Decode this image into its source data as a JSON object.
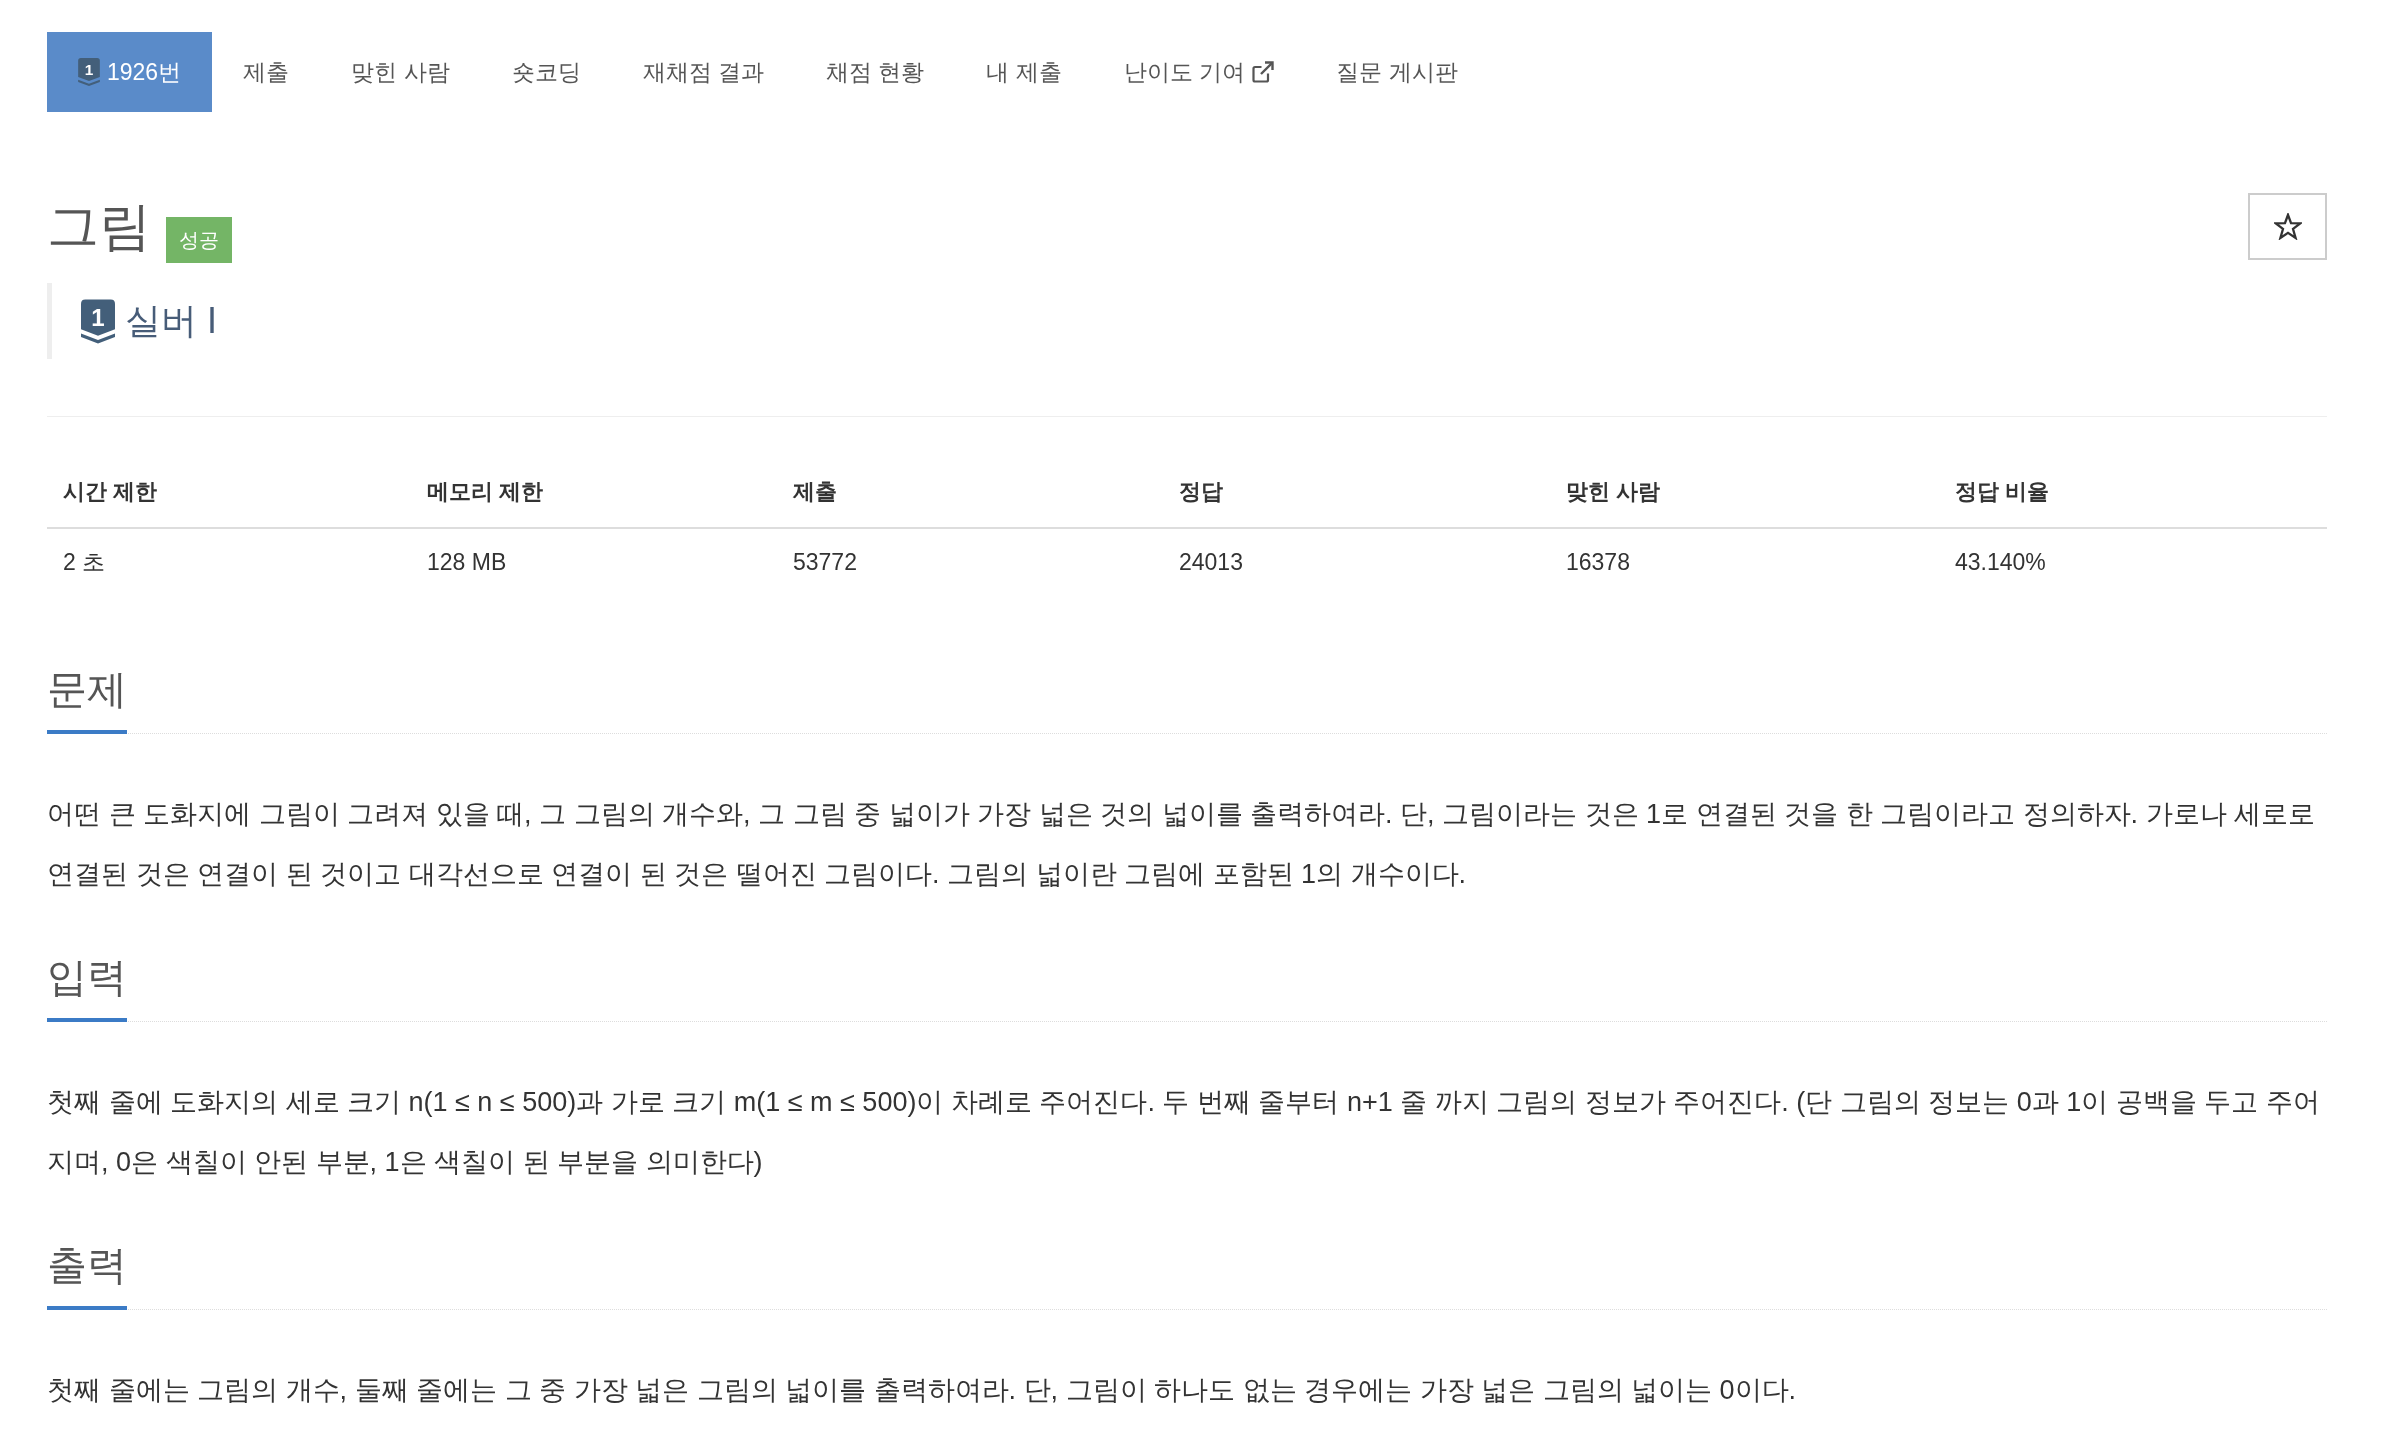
{
  "tabs": [
    {
      "label": "1926번",
      "tier_digit": "1",
      "selected": true,
      "external": false
    },
    {
      "label": "제출",
      "selected": false,
      "external": false
    },
    {
      "label": "맞힌 사람",
      "selected": false,
      "external": false
    },
    {
      "label": "숏코딩",
      "selected": false,
      "external": false
    },
    {
      "label": "재채점 결과",
      "selected": false,
      "external": false
    },
    {
      "label": "채점 현황",
      "selected": false,
      "external": false
    },
    {
      "label": "내 제출",
      "selected": false,
      "external": false
    },
    {
      "label": "난이도 기여",
      "selected": false,
      "external": true
    },
    {
      "label": "질문 게시판",
      "selected": false,
      "external": false
    }
  ],
  "problem": {
    "title": "그림",
    "status": "성공",
    "starred": false
  },
  "tier": {
    "digit": "1",
    "name": "실버 I"
  },
  "stats": {
    "columns": [
      "시간 제한",
      "메모리 제한",
      "제출",
      "정답",
      "맞힌 사람",
      "정답 비율"
    ],
    "rows": [
      [
        "2 초",
        "128 MB",
        "53772",
        "24013",
        "16378",
        "43.140%"
      ]
    ]
  },
  "sections": [
    {
      "heading": "문제",
      "text": "어떤 큰 도화지에 그림이 그려져 있을 때, 그 그림의 개수와, 그 그림 중 넓이가 가장 넓은 것의 넓이를 출력하여라. 단, 그림이라는 것은 1로 연결된 것을 한 그림이라고 정의하자. 가로나 세로로 연결된 것은 연결이 된 것이고 대각선으로 연결이 된 것은 떨어진 그림이다. 그림의 넓이란 그림에 포함된 1의 개수이다."
    },
    {
      "heading": "입력",
      "text": "첫째 줄에 도화지의 세로 크기 n(1 ≤ n ≤ 500)과 가로 크기 m(1 ≤ m ≤ 500)이 차례로 주어진다. 두 번째 줄부터 n+1 줄 까지 그림의 정보가 주어진다. (단 그림의 정보는 0과 1이 공백을 두고 주어지며, 0은 색칠이 안된 부분, 1은 색칠이 된 부분을 의미한다)"
    },
    {
      "heading": "출력",
      "text": "첫째 줄에는 그림의 개수, 둘째 줄에는 그 중 가장 넓은 그림의 넓이를 출력하여라. 단, 그림이 하나도 없는 경우에는 가장 넓은 그림의 넓이는 0이다."
    }
  ]
}
